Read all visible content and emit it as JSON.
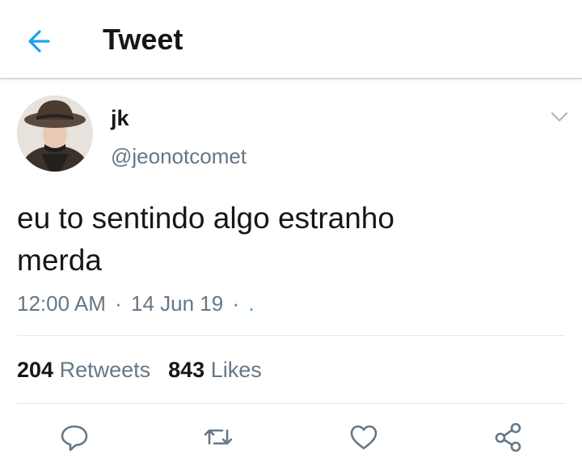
{
  "header": {
    "title": "Tweet",
    "back_icon": "arrow-left-icon",
    "accent_color": "#1da1f2"
  },
  "tweet": {
    "author": {
      "display_name": "jk",
      "handle": "@jeonotcomet"
    },
    "text_line1": "eu to sentindo algo estranho",
    "text_line2": "merda",
    "time": "12:00 AM",
    "date": "14 Jun 19",
    "separator": "·",
    "via": "."
  },
  "stats": {
    "retweets_count": "204",
    "retweets_label": "Retweets",
    "likes_count": "843",
    "likes_label": "Likes"
  },
  "actions": {
    "reply_icon": "reply-icon",
    "retweet_icon": "retweet-icon",
    "like_icon": "heart-icon",
    "share_icon": "share-icon"
  },
  "colors": {
    "text": "#14171a",
    "secondary": "#657786",
    "divider": "#e1e8ed"
  }
}
